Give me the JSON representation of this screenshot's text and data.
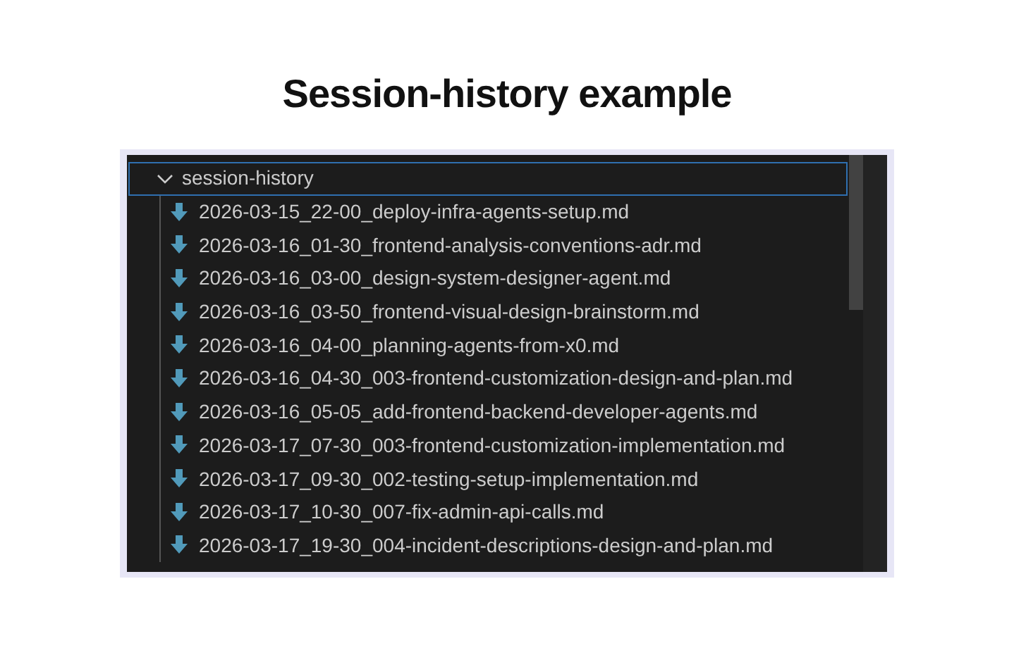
{
  "title": "Session-history example",
  "folder": {
    "name": "session-history",
    "expanded": true,
    "selected": true,
    "children": [
      {
        "name": "2026-03-15_22-00_deploy-infra-agents-setup.md"
      },
      {
        "name": "2026-03-16_01-30_frontend-analysis-conventions-adr.md"
      },
      {
        "name": "2026-03-16_03-00_design-system-designer-agent.md"
      },
      {
        "name": "2026-03-16_03-50_frontend-visual-design-brainstorm.md"
      },
      {
        "name": "2026-03-16_04-00_planning-agents-from-x0.md"
      },
      {
        "name": "2026-03-16_04-30_003-frontend-customization-design-and-plan.md"
      },
      {
        "name": "2026-03-16_05-05_add-frontend-backend-developer-agents.md"
      },
      {
        "name": "2026-03-17_07-30_003-frontend-customization-implementation.md"
      },
      {
        "name": "2026-03-17_09-30_002-testing-setup-implementation.md"
      },
      {
        "name": "2026-03-17_10-30_007-fix-admin-api-calls.md"
      },
      {
        "name": "2026-03-17_19-30_004-incident-descriptions-design-and-plan.md"
      }
    ]
  }
}
